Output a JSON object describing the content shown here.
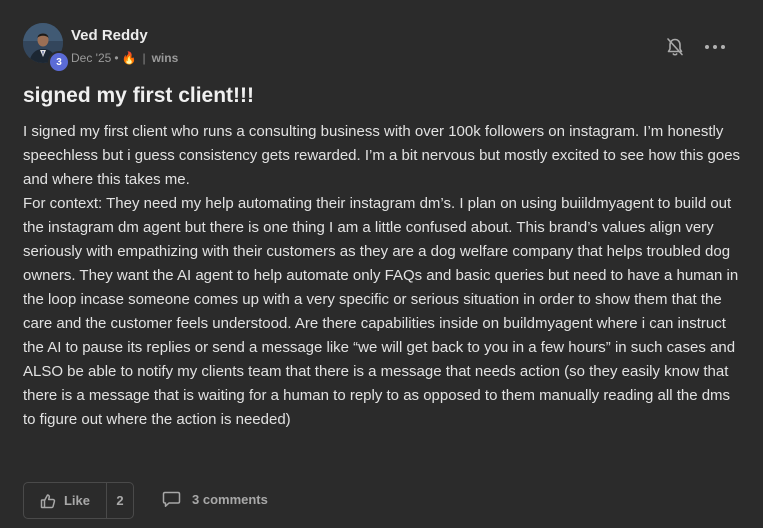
{
  "author": {
    "name": "Ved Reddy",
    "level": "3"
  },
  "meta": {
    "date": "Dec '25",
    "separator": "•",
    "fire_emoji": "🔥",
    "pipe": "|",
    "category": "wins"
  },
  "post": {
    "title": "signed my first client!!!",
    "paragraphs": [
      "I signed my first client who runs a consulting business with over 100k followers on instagram. I’m honestly speechless but i guess consistency gets rewarded. I’m a bit nervous but mostly excited to see how this goes and where this takes me.",
      "For context: They need my help automating their instagram dm’s. I plan on using buiildmyagent to build out the instagram dm agent but there is one thing I am a little confused about. This brand’s values align very seriously with empathizing with their customers as they are a dog welfare company that helps troubled dog owners. They want the AI agent to help automate only FAQs and basic queries but need to have a human in the loop incase someone comes up with a very specific or serious situation in order to show them that the care and the customer feels understood. Are there capabilities inside on buildmyagent where i can instruct the AI to pause its replies or send a message like “we will get back to you in a few hours” in such cases and ALSO be able to notify my clients team that there is a message that needs action (so they easily know that there is a message that is waiting for a human to reply to as opposed to them manually reading all the dms to figure out where the action is needed)"
    ]
  },
  "actions": {
    "like_label": "Like",
    "like_count": "2",
    "comments_label": "3 comments"
  },
  "icons": {
    "notification": "bell-off-icon",
    "more": "more-horizontal-icon",
    "like": "thumbs-up-icon",
    "comment": "comment-icon"
  },
  "colors": {
    "background": "#2b2b2b",
    "badge": "#5b6bd6"
  }
}
